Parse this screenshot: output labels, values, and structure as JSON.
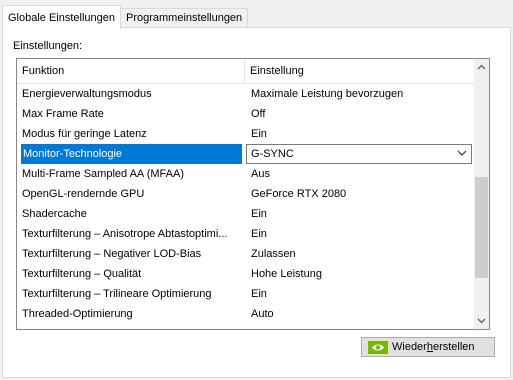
{
  "tabs": [
    {
      "label": "Globale Einstellungen",
      "active": true
    },
    {
      "label": "Programmeinstellungen",
      "active": false
    }
  ],
  "settings_label": "Einstellungen:",
  "columns": {
    "function": "Funktion",
    "setting": "Einstellung"
  },
  "rows": [
    {
      "function": "Energieverwaltungsmodus",
      "setting": "Maximale Leistung bevorzugen"
    },
    {
      "function": "Max Frame Rate",
      "setting": "Off"
    },
    {
      "function": "Modus für geringe Latenz",
      "setting": "Ein"
    },
    {
      "function": "Monitor-Technologie",
      "setting": "G-SYNC",
      "selected": true
    },
    {
      "function": "Multi-Frame Sampled AA (MFAA)",
      "setting": "Aus"
    },
    {
      "function": "OpenGL-rendernde GPU",
      "setting": "GeForce RTX 2080"
    },
    {
      "function": "Shadercache",
      "setting": "Ein"
    },
    {
      "function": "Texturfilterung – Anisotrope Abtastoptimi...",
      "setting": "Ein"
    },
    {
      "function": "Texturfilterung – Negativer LOD-Bias",
      "setting": "Zulassen"
    },
    {
      "function": "Texturfilterung – Qualität",
      "setting": "Hohe Leistung"
    },
    {
      "function": "Texturfilterung – Trilineare Optimierung",
      "setting": "Ein"
    },
    {
      "function": "Threaded-Optimierung",
      "setting": "Auto"
    }
  ],
  "restore_button": {
    "prefix": "Wieder",
    "underlined": "h",
    "suffix": "erstellen"
  },
  "colors": {
    "selection": "#0078d7",
    "nvidia_green": "#76b900"
  },
  "icons": {
    "combo_arrow": "chevron-down-icon",
    "scroll_up": "arrow-up-icon",
    "scroll_down": "arrow-down-icon",
    "button_logo": "nvidia-logo-icon"
  }
}
